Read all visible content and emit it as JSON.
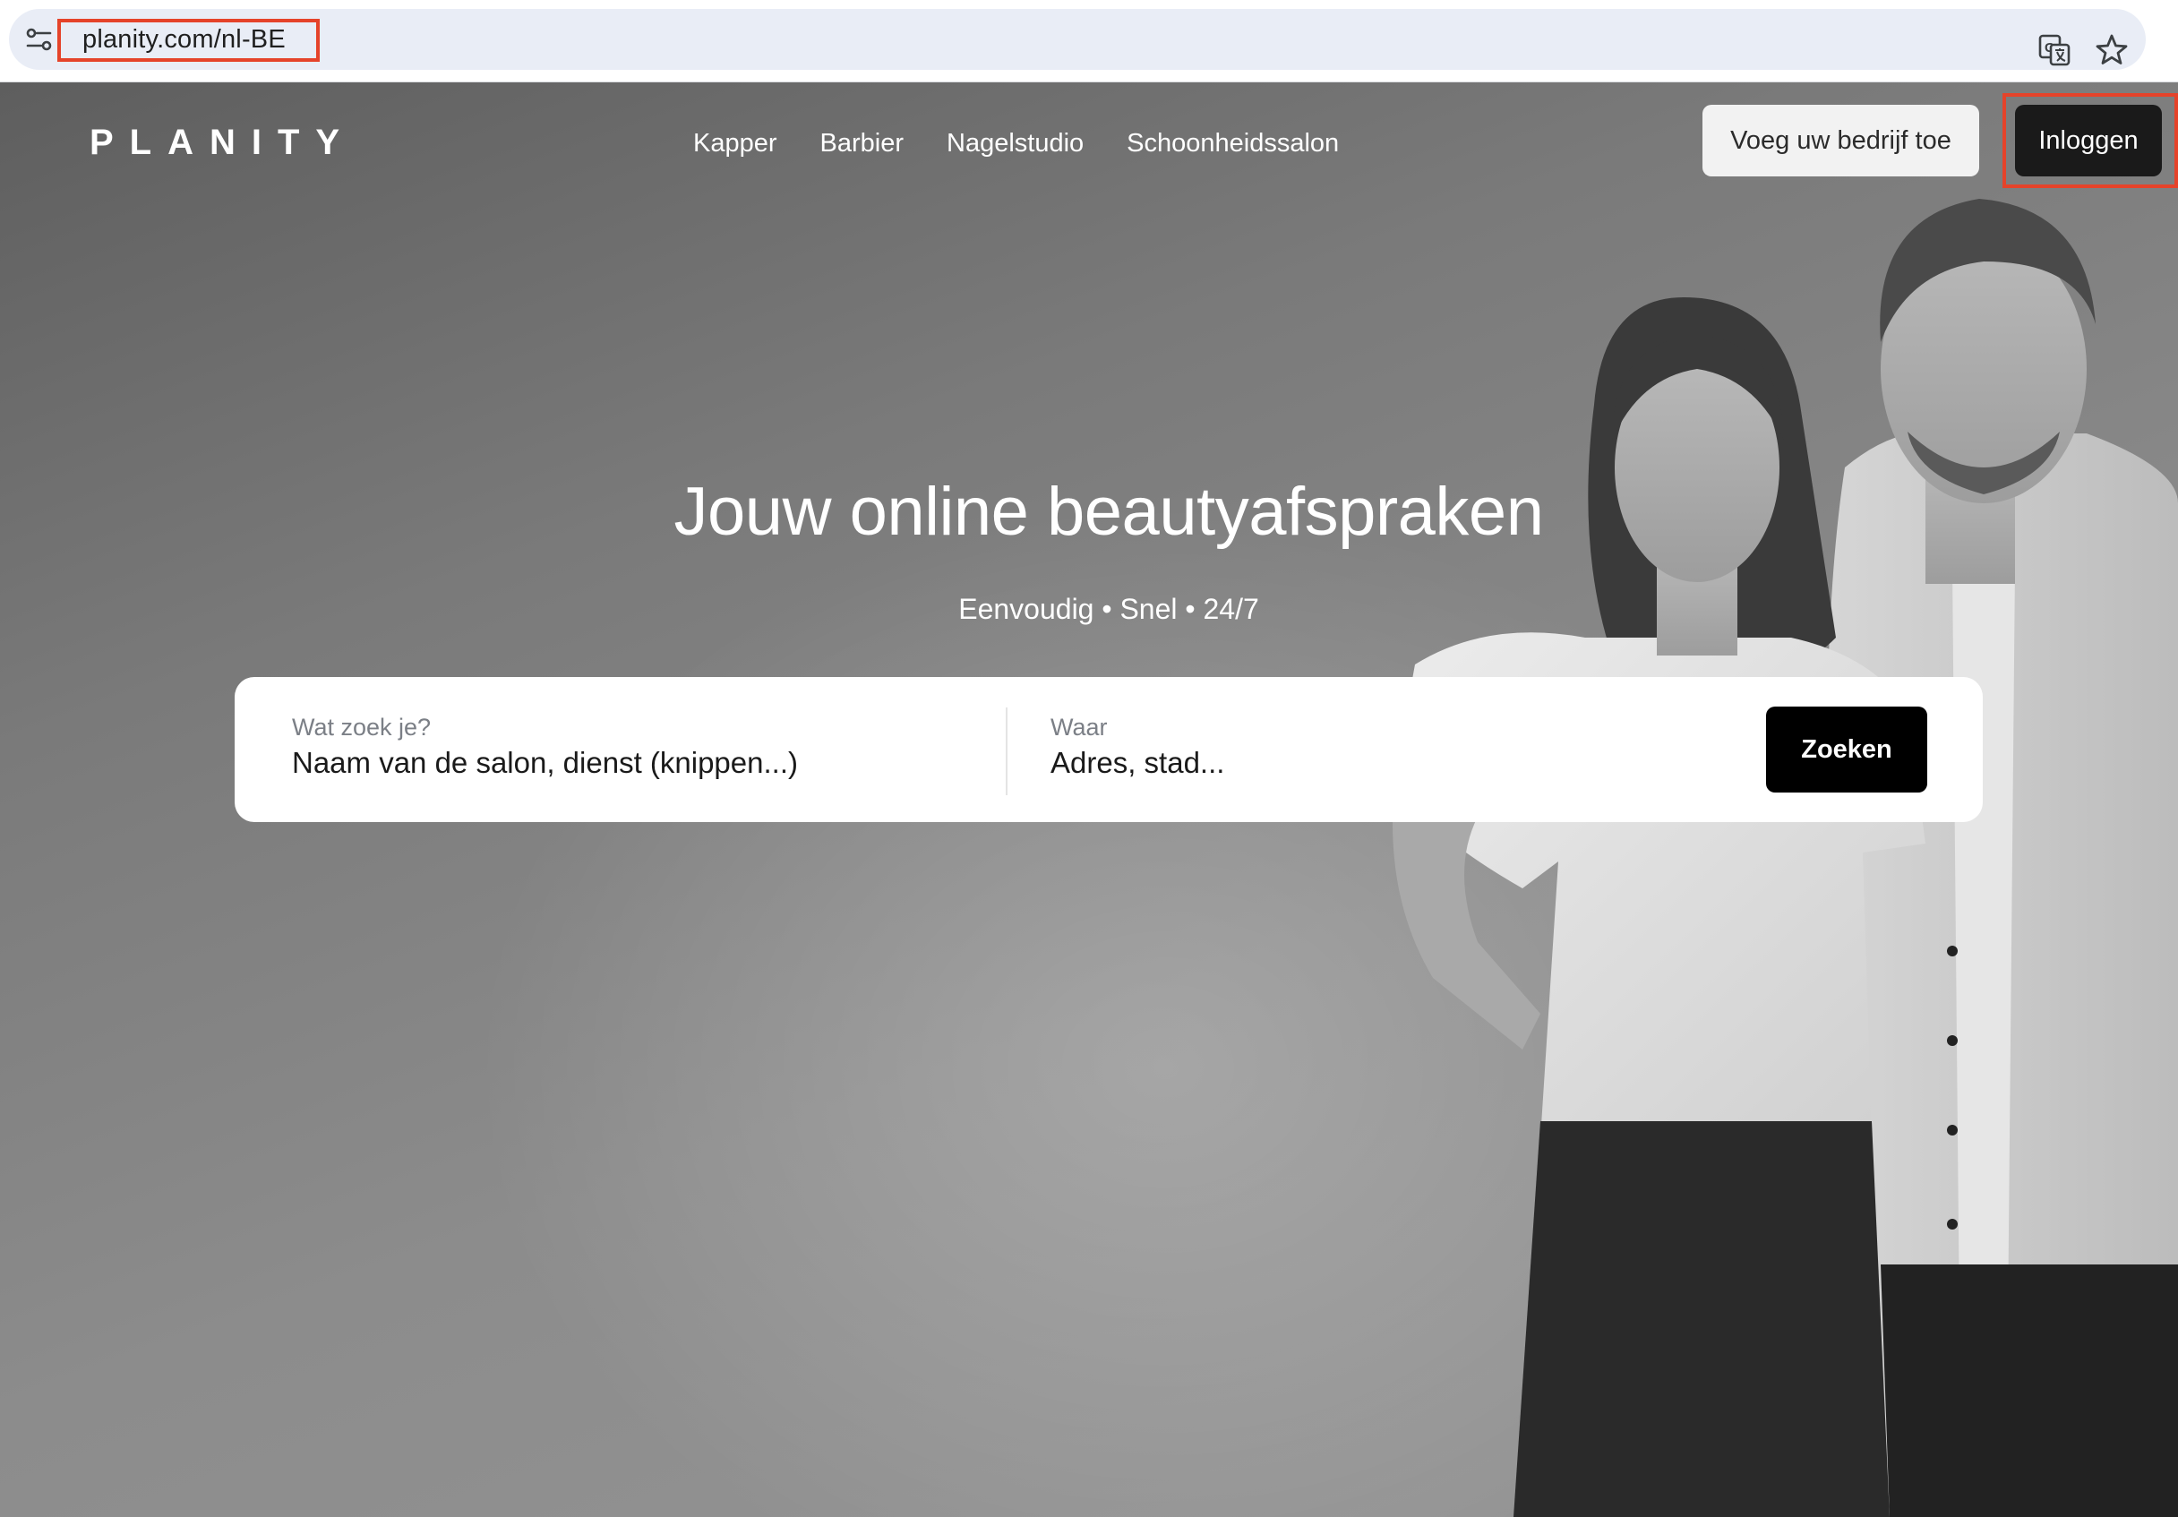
{
  "browser": {
    "url": "planity.com/nl-BE",
    "site_info_icon": "tune-icon",
    "translate_icon": "google-translate-icon",
    "bookmark_icon": "star-icon"
  },
  "header": {
    "logo": "PLANITY",
    "nav": [
      {
        "label": "Kapper"
      },
      {
        "label": "Barbier"
      },
      {
        "label": "Nagelstudio"
      },
      {
        "label": "Schoonheidssalon"
      }
    ],
    "add_business_label": "Voeg uw bedrijf toe",
    "login_label": "Inloggen"
  },
  "hero": {
    "headline": "Jouw online beautyafspraken",
    "subtitle": "Eenvoudig • Snel • 24/7"
  },
  "search": {
    "what_label": "Wat zoek je?",
    "what_placeholder": "Naam van de salon, dienst (knippen...)",
    "where_label": "Waar",
    "where_placeholder": "Adres, stad...",
    "submit_label": "Zoeken"
  },
  "colors": {
    "highlight": "#e5432a",
    "login_button": "#1a1a1a",
    "search_button": "#000000"
  }
}
